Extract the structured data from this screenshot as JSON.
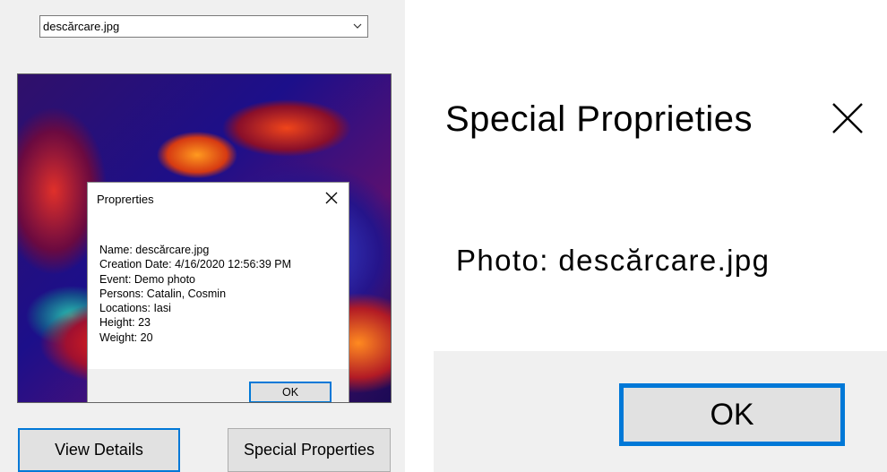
{
  "main_window": {
    "photo_select": {
      "value": "descărcare.jpg"
    },
    "buttons": {
      "view_details": "View Details",
      "special_properties": "Special Properties"
    }
  },
  "properties_dialog": {
    "title": "Proprerties",
    "lines": [
      "Name: descărcare.jpg",
      "Creation Date: 4/16/2020 12:56:39 PM",
      "Event: Demo photo",
      "Persons: Catalin, Cosmin",
      "Locations: Iasi",
      "Height: 23",
      "Weight: 20"
    ],
    "ok_label": "OK"
  },
  "special_dialog": {
    "title": "Special Proprieties",
    "photo_text": "Photo: descărcare.jpg",
    "ok_label": "OK"
  },
  "colors": {
    "accent": "#0078d7",
    "window_bg": "#f0f0f0",
    "button_bg": "#e1e1e1"
  },
  "icons": {
    "dropdown": "chevron-down-icon",
    "close": "close-icon"
  }
}
